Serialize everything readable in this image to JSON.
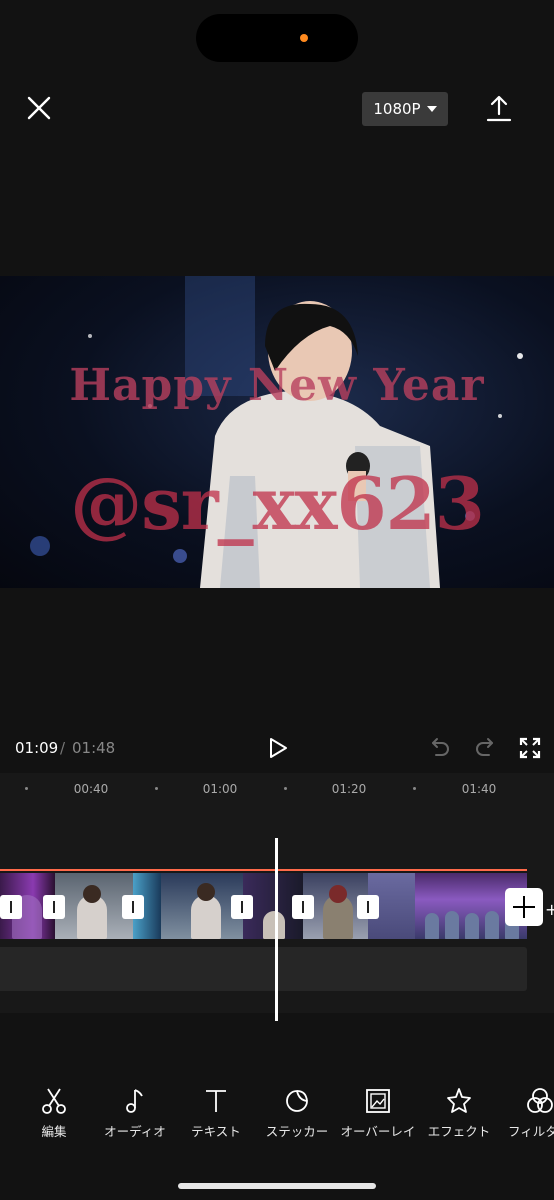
{
  "header": {
    "resolution_label": "1080P",
    "icons": [
      "close-icon",
      "chevron-down-icon",
      "export-icon"
    ]
  },
  "preview": {
    "overlay_text_1": "Happy New Year",
    "overlay_text_2": "@sr_xx623",
    "overlay_color": "#c0304a"
  },
  "playback": {
    "current_time": "01:09",
    "separator": "/",
    "total_time": "01:48",
    "icons": [
      "play-icon",
      "undo-icon",
      "redo-icon",
      "fullscreen-icon"
    ]
  },
  "timeline": {
    "ruler_labels": [
      "00:40",
      "01:00",
      "01:20",
      "01:40"
    ],
    "add_clip_edge_label": "+",
    "track_border_color": "#ff6a4a"
  },
  "toolbar": {
    "items": [
      {
        "label": "編集",
        "icon": "scissors-icon"
      },
      {
        "label": "オーディオ",
        "icon": "music-note-icon"
      },
      {
        "label": "テキスト",
        "icon": "text-icon"
      },
      {
        "label": "ステッカー",
        "icon": "sticker-icon"
      },
      {
        "label": "オーバーレイ",
        "icon": "overlay-icon"
      },
      {
        "label": "エフェクト",
        "icon": "effect-star-icon"
      },
      {
        "label": "フィルター",
        "icon": "filter-icon"
      }
    ]
  }
}
